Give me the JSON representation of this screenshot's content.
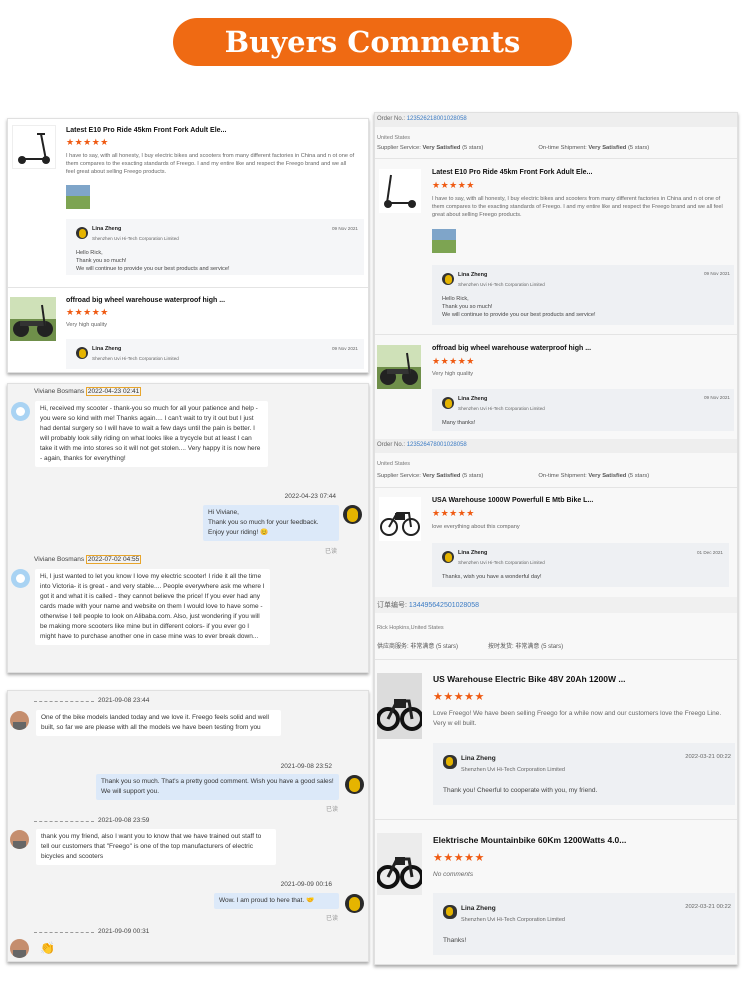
{
  "header": {
    "title": "Buyers Comments"
  },
  "left1": {
    "review1": {
      "title": "Latest E10 Pro Ride 45km Front Fork Adult Ele...",
      "stars": "★★★★★",
      "text": "I have to say, with all honesty, I buy electric bikes and scooters from many different factories in China and n ot one of them compares to the exacting standards of Freego.  I and my entire like and respect the Freego brand and we all feel great about selling Freego products.",
      "reply": {
        "name": "Lina Zheng",
        "company": "Shenzhen Uvi Hi-Tech Corporation Limited",
        "date": "09 Nov 2021",
        "msg1": "Hello Rick,",
        "msg2": "Thank you so much!",
        "msg3": "We will continue to provide you our best products and service!"
      }
    },
    "review2": {
      "title": "offroad big wheel warehouse waterproof high ...",
      "stars": "★★★★★",
      "text": "Very high quality",
      "reply": {
        "name": "Lina Zheng",
        "company": "Shenzhen Uvi Hi-Tech Corporation Limited",
        "date": "09 Nov 2021"
      }
    }
  },
  "left2": {
    "msg1": {
      "name": "Viviane Bosmans",
      "time": "2022-04-23 02:41",
      "text": "Hi, received my scooter - thank-you so much for all your patience and help - you were so kind with me! Thanks again.... I can't wait to try it out but I just had dental surgery so I will have to wait a few days until the pain is better. I will probably look silly riding on what looks like a trycycle but at least I can take it with me into stores so it will not get stolen.... Very happy it is now here - again, thanks for everything!"
    },
    "msg2": {
      "time": "2022-04-23 07:44",
      "line1": "Hi Viviane,",
      "line2": "Thank you so much for your feedback.",
      "line3": "Enjoy your riding! 😊",
      "read": "已读"
    },
    "msg3": {
      "name": "Viviane Bosmans",
      "time": "2022-07-02 04:55",
      "text": "Hi, I just wanted to let you know I love my electric scooter! I ride it all the time into Victoria- it is great - and very stable.... People everywhere ask me where I got it and what it is called - they cannot believe the price! If you ever had any cards made with your name and website on them I would love to have some - otherwise I tell people to look on Alibaba.com. Also, just wondering if you will be making more scooters like mine but in different colors- if you ever go I might have to purchase another one in case mine was to ever break down..."
    }
  },
  "left3": {
    "m1": {
      "time": "2021-09-08 23:44",
      "text": "One of the bike models landed today and we love it.  Freego feels solid and well built, so far we are please with all the models we have been testing from you"
    },
    "m2": {
      "time": "2021-09-08 23:52",
      "text": "Thank you so much. That's a pretty good comment. Wish you have a good sales! We will support you.",
      "read": "已读"
    },
    "m3": {
      "time": "2021-09-08 23:59",
      "text": "thank you my friend, also I want you to know that we have trained out staff to tell our customers that \"Freego\" is one of the top manufacturers of electric bicycles and scooters"
    },
    "m4": {
      "time": "2021-09-09 00:16",
      "text": "Wow. I am proud to here that. 🤝",
      "read": "已读"
    },
    "m5": {
      "time": "2021-09-09 00:31",
      "emoji": "👏"
    }
  },
  "right": {
    "order1": {
      "label": "Order No.:",
      "no": "123526218001028058"
    },
    "sub1": "United States",
    "svc1": {
      "supplier": "Supplier Service:",
      "supplier_val": "Very Satisfied",
      "supplier_stars": "(5 stars)",
      "ship": "On-time Shipment:",
      "ship_val": "Very Satisfied",
      "ship_stars": "(5 stars)"
    },
    "r1": {
      "title": "Latest E10 Pro Ride 45km Front Fork Adult Ele...",
      "stars": "★★★★★",
      "text": "I have to say, with all honesty, I buy electric bikes and scooters from many different factories in China and n ot one of them compares to the exacting standards of Freego.  I and my entire like and respect the Freego brand and we all feel great about selling Freego products.",
      "name": "Lina Zheng",
      "company": "Shenzhen Uvi Hi-Tech Corporation Limited",
      "date": "09 Nov 2021",
      "msg1": "Hello Rick,",
      "msg2": "Thank you so much!",
      "msg3": "We will continue to provide you our best products and service!"
    },
    "r2": {
      "title": "offroad big wheel warehouse waterproof high ...",
      "stars": "★★★★★",
      "text": "Very high quality",
      "name": "Lina Zheng",
      "company": "Shenzhen Uvi Hi-Tech Corporation Limited",
      "date": "09 Nov 2021",
      "msg": "Many thanks!"
    },
    "order2": {
      "label": "Order No.:",
      "no": "123526478001028058"
    },
    "sub2": "United States",
    "svc2": {
      "supplier": "Supplier Service:",
      "supplier_val": "Very Satisfied",
      "supplier_stars": "(5 stars)",
      "ship": "On-time Shipment:",
      "ship_val": "Very Satisfied",
      "ship_stars": "(5 stars)"
    },
    "r3": {
      "title": "USA Warehouse 1000W Powerfull E Mtb Bike L...",
      "stars": "★★★★★",
      "text": "love everything about this company",
      "name": "Lina Zheng",
      "company": "Shenzhen Uvi Hi-Tech Corporation Limited",
      "date": "01 Dec 2021",
      "msg": "Thanks, wish you have a wonderful day!"
    },
    "order3": {
      "label": "订单编号:",
      "no": "134495642501028058"
    },
    "sub3": "Rick Hopkins,United States",
    "svc3": {
      "supplier": "供应商服务:",
      "supplier_val": "非常满意",
      "supplier_stars": "(5 stars)",
      "ship": "按时发货:",
      "ship_val": "非常满意",
      "ship_stars": "(5 stars)"
    },
    "r4": {
      "title": "US Warehouse Electric Bike 48V 20Ah 1200W ...",
      "stars": "★★★★★",
      "text": "Love Freego!  We have been selling Freego for a while now and our customers love the Freego Line.  Very w ell built.",
      "name": "Lina Zheng",
      "company": "Shenzhen Uvi Hi-Tech Corporation Limited",
      "date": "2022-03-21 00:22",
      "msg": "Thank you! Cheerful to cooperate with you, my friend."
    },
    "r5": {
      "title": "Elektrische Mountainbike 60Km 1200Watts 4.0...",
      "stars": "★★★★★",
      "text": "No comments",
      "name": "Lina Zheng",
      "company": "Shenzhen Uvi Hi-Tech Corporation Limited",
      "date": "2022-03-21 00:22",
      "msg": "Thanks!"
    }
  }
}
